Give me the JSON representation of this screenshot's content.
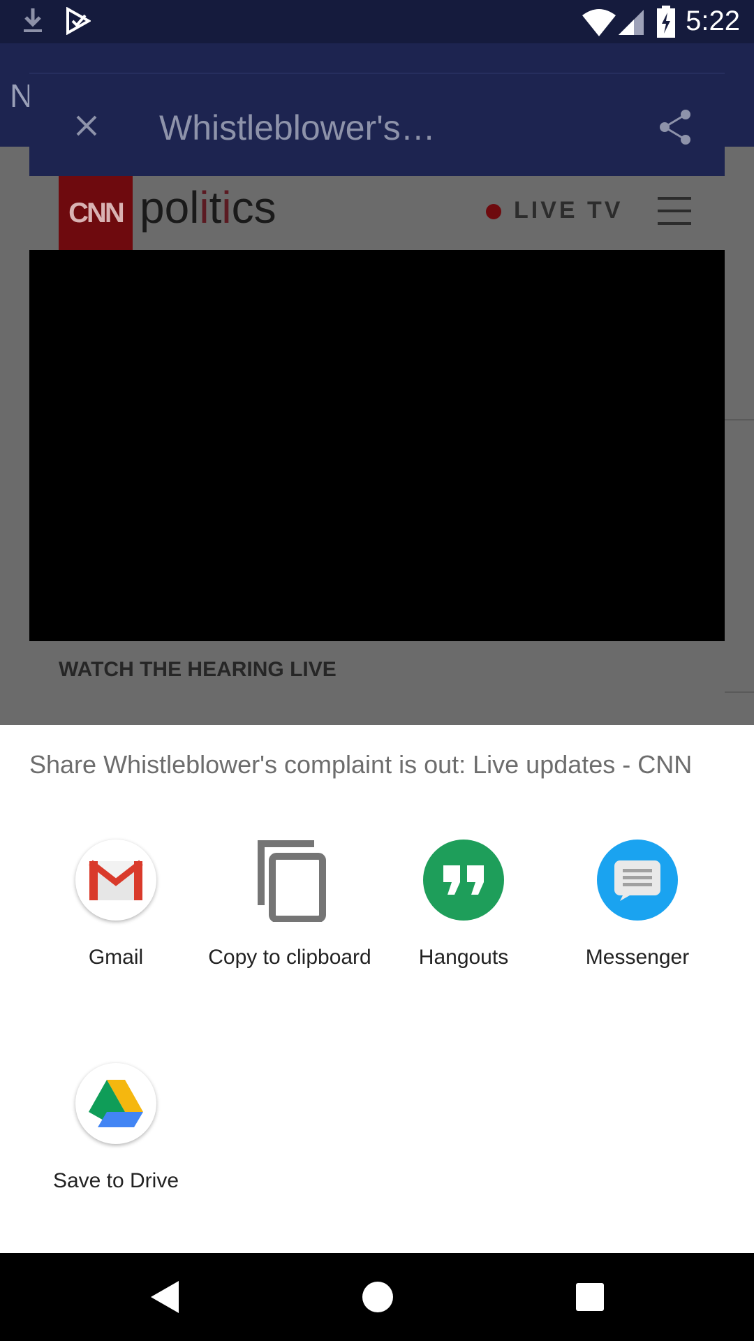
{
  "status_bar": {
    "time": "5:22",
    "icons": [
      "download-icon",
      "play-store-icon",
      "wifi-icon",
      "signal-icon",
      "battery-charging-icon"
    ]
  },
  "background_app": {
    "app_bar_letter": "N",
    "tab": {
      "title": "Whistleblower's…",
      "close_icon": "close-icon",
      "share_icon": "share-icon"
    },
    "header": {
      "logo_text": "CNN",
      "section_text": "politics",
      "live_tv": "LIVE TV",
      "menu_icon": "hamburger-icon"
    },
    "video_caption": "WATCH THE HEARING LIVE"
  },
  "share_sheet": {
    "title": "Share Whistleblower's complaint is out: Live updates - CNN",
    "targets": [
      {
        "label": "Gmail",
        "icon": "gmail-icon"
      },
      {
        "label": "Copy to clipboard",
        "icon": "clipboard-icon"
      },
      {
        "label": "Hangouts",
        "icon": "hangouts-icon"
      },
      {
        "label": "Messenger",
        "icon": "messenger-icon"
      },
      {
        "label": "Save to Drive",
        "icon": "drive-icon"
      }
    ]
  },
  "nav_bar": {
    "back": "back-icon",
    "home": "home-icon",
    "recents": "recents-icon"
  },
  "colors": {
    "status_bar": "#151b3d",
    "app_bar": "#1d2450",
    "scrim": "#6b6b6b",
    "hangouts_green": "#1e9e5a",
    "messenger_blue": "#1aa3f0",
    "gmail_red": "#d93a2b"
  }
}
